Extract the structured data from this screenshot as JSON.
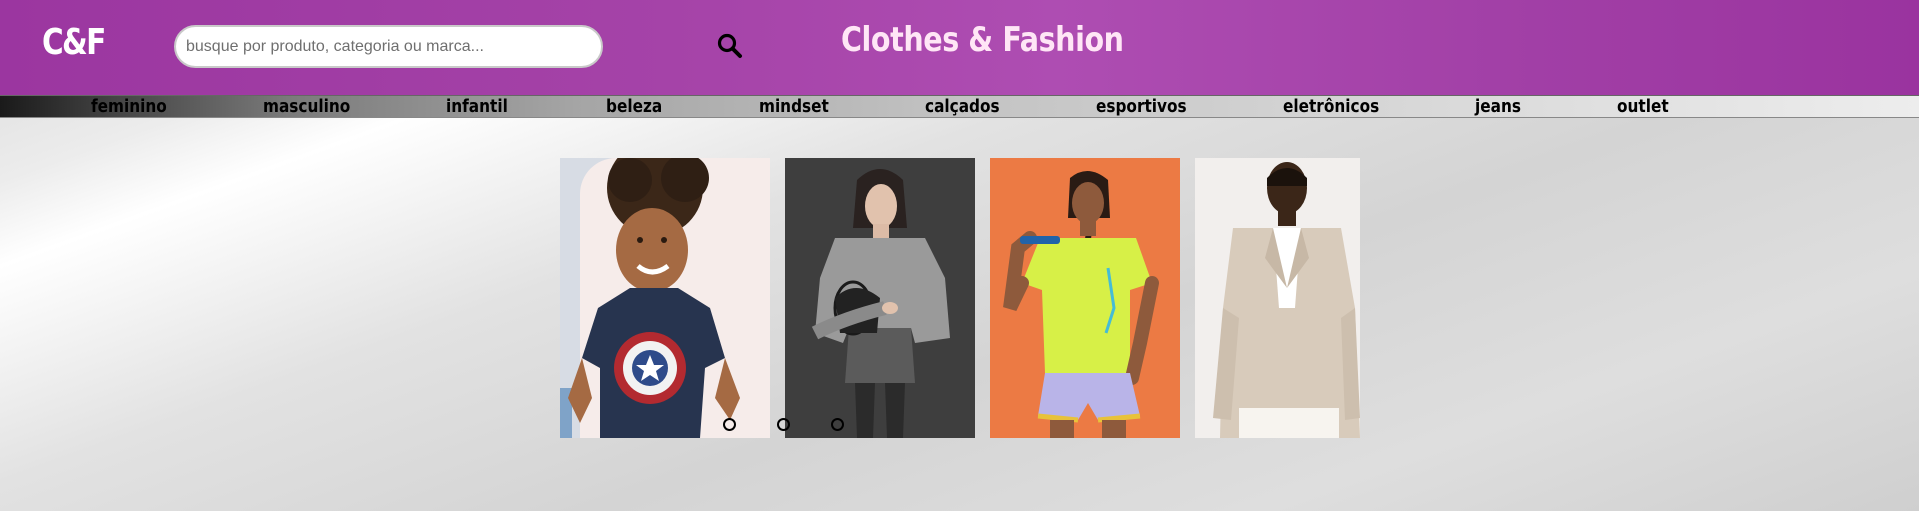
{
  "header": {
    "logo": "C&F",
    "search": {
      "placeholder": "busque por produto, categoria ou marca...",
      "value": ""
    },
    "search_icon": "search-icon",
    "title": "Clothes & Fashion",
    "colors": {
      "header_bg": "#a543a8",
      "title": "#ffe6f6"
    }
  },
  "nav": {
    "items": [
      {
        "label": "feminino"
      },
      {
        "label": "masculino"
      },
      {
        "label": "infantil"
      },
      {
        "label": "beleza"
      },
      {
        "label": "mindset"
      },
      {
        "label": "calçados"
      },
      {
        "label": "esportivos"
      },
      {
        "label": "eletrônicos"
      },
      {
        "label": "jeans"
      },
      {
        "label": "outlet"
      }
    ]
  },
  "carousel": {
    "slides": [
      {
        "image": "boy-captain-america-tshirt-photo"
      },
      {
        "image": "woman-grey-cardigan-photo"
      },
      {
        "image": "woman-neon-sports-top-photo"
      },
      {
        "image": "man-beige-blazer-photo"
      }
    ],
    "dots": 3,
    "active_dot": 0
  }
}
